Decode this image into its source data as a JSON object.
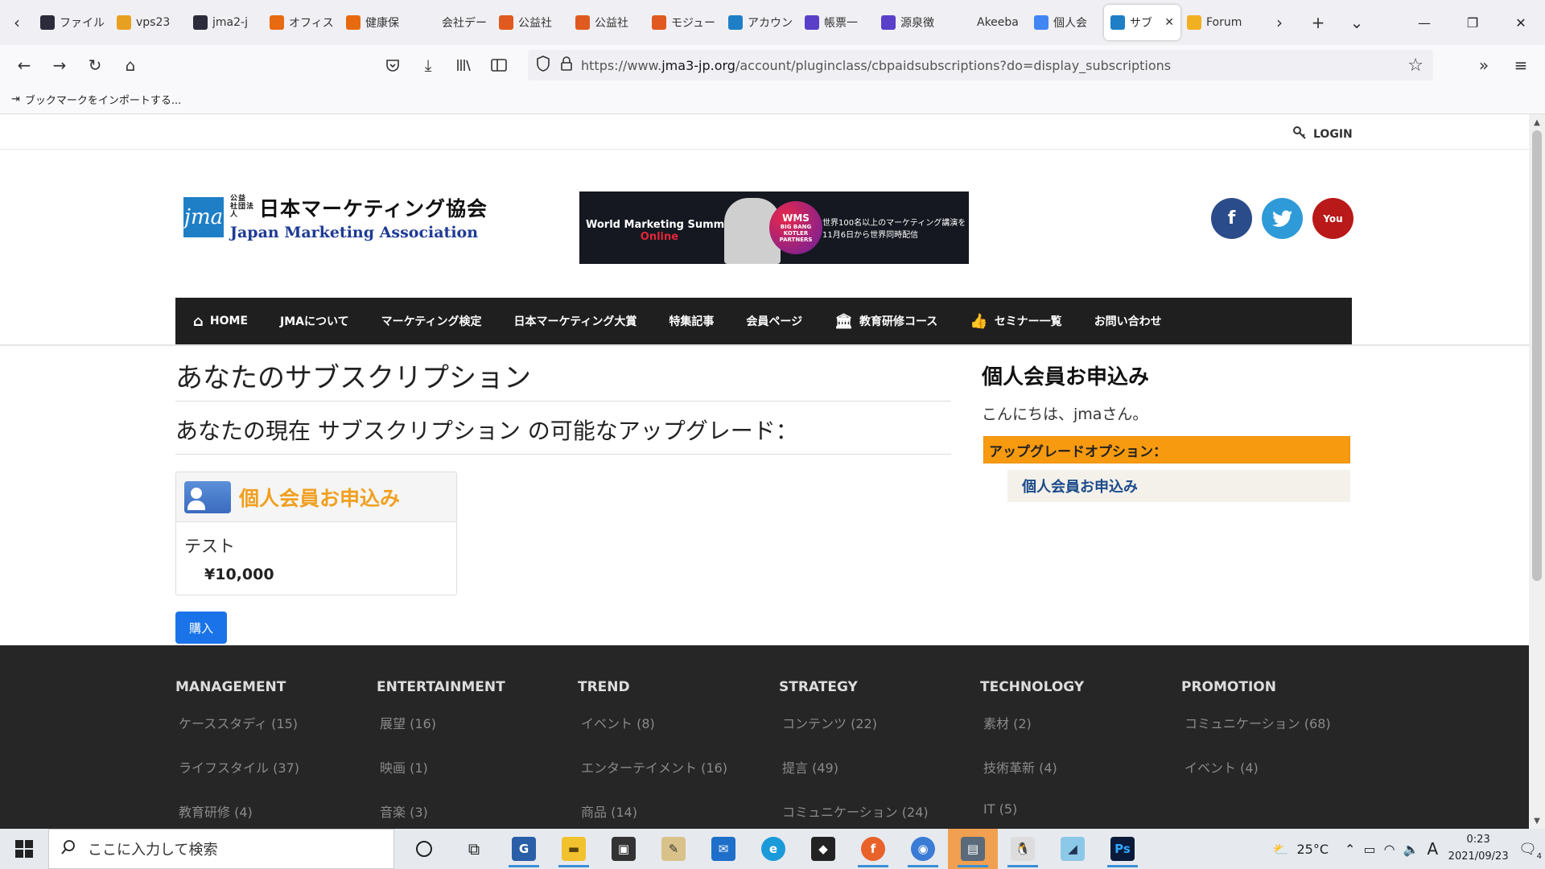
{
  "browser": {
    "tabs": [
      {
        "label": "ファイル",
        "icon": "p-circle-icon",
        "color": "#2b2b3c"
      },
      {
        "label": "vps23",
        "icon": "pma-icon",
        "color": "#e8a020"
      },
      {
        "label": "jma2-j",
        "icon": "p-circle-icon",
        "color": "#2b2b3c"
      },
      {
        "label": "オフィス",
        "icon": "office-icon",
        "color": "#e86a10"
      },
      {
        "label": "健康保",
        "icon": "office-icon",
        "color": "#e86a10"
      },
      {
        "label": "会社データ",
        "icon": "",
        "color": "#999999"
      },
      {
        "label": "公益社",
        "icon": "joomla-icon",
        "color": "#e05a20"
      },
      {
        "label": "公益社",
        "icon": "joomla-icon",
        "color": "#e05a20"
      },
      {
        "label": "モジュー",
        "icon": "joomla-icon",
        "color": "#e05a20"
      },
      {
        "label": "アカウン",
        "icon": "jma-icon",
        "color": "#1f7fc6"
      },
      {
        "label": "帳票一",
        "icon": "chart-icon",
        "color": "#5a3fc8"
      },
      {
        "label": "源泉徴",
        "icon": "chart-icon",
        "color": "#5a3fc8"
      },
      {
        "label": "Akeeba Ba",
        "icon": "",
        "color": "#999999"
      },
      {
        "label": "個人会",
        "icon": "google-icon",
        "color": "#4285f4"
      },
      {
        "label": "サブ",
        "icon": "jma-icon",
        "color": "#1f7fc6",
        "active": true
      },
      {
        "label": "Forum",
        "icon": "forum-icon",
        "color": "#f0b020"
      }
    ],
    "url_prefix": "https://www.",
    "url_domain": "jma3-jp.org",
    "url_path": "/account/pluginclass/cbpaidsubscriptions?do=display_subscriptions",
    "bookmark_import": "ブックマークをインポートする..."
  },
  "page": {
    "login": "LOGIN",
    "logo": {
      "small_top": "公益",
      "small_bottom": "社団法人",
      "jp": "日本マーケティング協会",
      "en": "Japan Marketing Association",
      "mark": "jma"
    },
    "banner": {
      "title": "World Marketing Summit",
      "sub": "Online",
      "badge_1": "WMS",
      "badge_2": "BIG BANG",
      "badge_3": "KOTLER",
      "badge_4": "PARTNERS",
      "right_1": "世界100名以上のマーケティング講演を",
      "right_2": "11月6日から世界同時配信"
    },
    "social": {
      "facebook": "f",
      "twitter": "t",
      "youtube": "You"
    },
    "nav": [
      "HOME",
      "JMAについて",
      "マーケティング検定",
      "日本マーケティング大賞",
      "特集記事",
      "会員ページ",
      "教育研修コース",
      "セミナー一覧",
      "お問い合わせ"
    ],
    "heading": "あなたのサブスクリプション",
    "upgrade_heading": "あなたの現在 サブスクリプション の可能なアップグレード：",
    "plan": {
      "title": "個人会員お申込み",
      "desc": "テスト",
      "price": "¥10,000"
    },
    "buy_button": "購入",
    "sidebar": {
      "title": "個人会員お申込み",
      "greeting": "こんにちは、jmaさん。",
      "upgrade_options": "アップグレードオプション：",
      "link": "個人会員お申込み"
    },
    "footer": [
      {
        "heading": "MANAGEMENT",
        "items": [
          "ケーススタディ (15)",
          "ライフスタイル (37)",
          "教育研修 (4)"
        ]
      },
      {
        "heading": "ENTERTAINMENT",
        "items": [
          "展望 (16)",
          "映画 (1)",
          "音楽 (3)"
        ]
      },
      {
        "heading": "TREND",
        "items": [
          "イベント (8)",
          "エンターテイメント (16)",
          "商品 (14)"
        ]
      },
      {
        "heading": "STRATEGY",
        "items": [
          "コンテンツ (22)",
          "提言 (49)",
          "コミュニケーション (24)"
        ]
      },
      {
        "heading": "TECHNOLOGY",
        "items": [
          "素材 (2)",
          "技術革新 (4)",
          "IT (5)"
        ]
      },
      {
        "heading": "PROMOTION",
        "items": [
          "コミュニケーション (68)",
          "イベント (4)"
        ]
      }
    ]
  },
  "taskbar": {
    "search_placeholder": "ここに入力して検索",
    "temperature": "25°C",
    "time": "0:23",
    "date": "2021/09/23",
    "ime": "A",
    "notification_count": "4"
  }
}
